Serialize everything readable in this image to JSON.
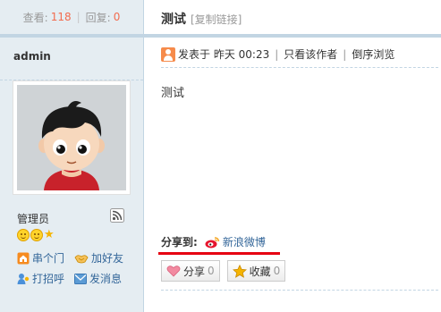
{
  "sidebar": {
    "views_label": "查看:",
    "views_count": "118",
    "replies_label": "回复:",
    "replies_count": "0",
    "author": "admin",
    "user_group": "管理员",
    "actions": [
      {
        "label": "串个门",
        "icon": "home-icon"
      },
      {
        "label": "加好友",
        "icon": "handshake-icon"
      },
      {
        "label": "打招呼",
        "icon": "greet-icon"
      },
      {
        "label": "发消息",
        "icon": "envelope-icon"
      }
    ]
  },
  "post": {
    "title": "测试",
    "copy_link": "[复制链接]",
    "posted_on": "发表于 昨天 00:23",
    "only_author": "只看该作者",
    "reverse_view": "倒序浏览",
    "content": "测试",
    "share_label": "分享到:",
    "weibo_label": "新浪微博",
    "share_button": "分享",
    "share_count": "0",
    "favorite_button": "收藏",
    "favorite_count": "0"
  },
  "colors": {
    "count_highlight": "#f26c4f",
    "band": "#c2d5e3",
    "sidebar_bg": "#e5edf2",
    "link": "#336699",
    "share_underline": "#e60012"
  }
}
